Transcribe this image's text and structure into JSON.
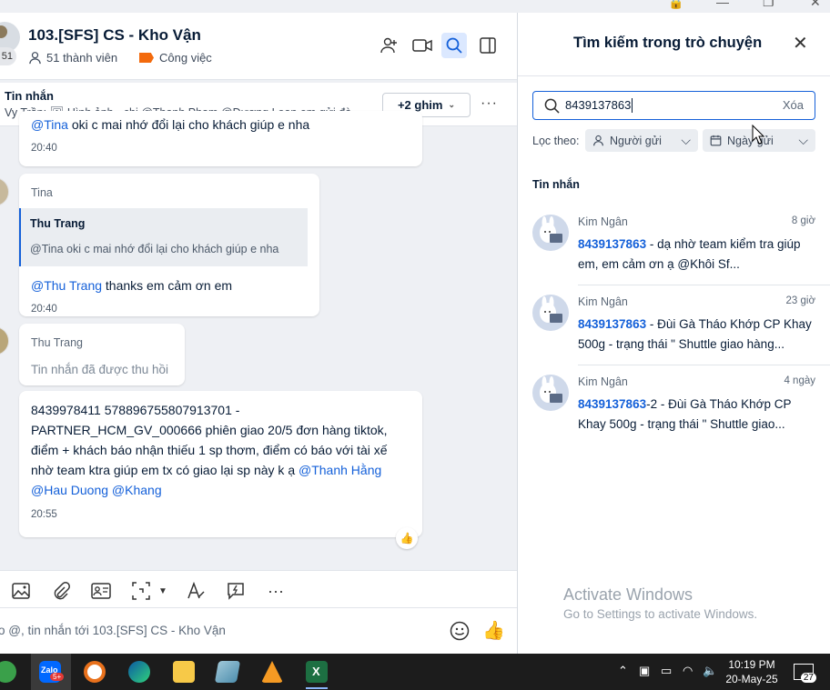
{
  "chat": {
    "title": "103.[SFS] CS - Kho Vận",
    "avatar_count": "51",
    "members": "51 thành viên",
    "tag": "Công việc",
    "tag_color": "#f36a0c"
  },
  "pinned": {
    "label": "Tin nhắn",
    "preview": "Vy Trần: 🖼 Hình ảnh · chị @Thanh Phạm @Dương Loan em gửi đà...",
    "more_button": "+2 ghim"
  },
  "messages": [
    {
      "mention": "@Tina",
      "text": " oki c mai nhớ đổi lại cho khách giúp e nha",
      "time": "20:40"
    },
    {
      "sender": "Tina",
      "quote_name": "Thu Trang",
      "quote_text": "@Tina oki c mai nhớ đổi lại cho khách giúp e nha",
      "mention": "@Thu Trang",
      "text": " thanks em cảm ơn em",
      "time": "20:40"
    },
    {
      "sender": "Thu Trang",
      "recalled": "Tin nhắn đã được thu hồi"
    },
    {
      "text": "8439978411 578896755807913701 - PARTNER_HCM_GV_000666 phiên giao 20/5 đơn hàng tiktok, điểm + khách báo nhận thiếu 1 sp thơm, điểm có báo với tài xế nhờ team ktra giúp em tx có giao lại sp này k ạ ",
      "mentions": "@Thanh Hằng @Hau Duong @Khang",
      "time": "20:55"
    }
  ],
  "composer": {
    "placeholder": "o @, tin nhắn tới 103.[SFS] CS - Kho Vận"
  },
  "search_panel": {
    "title": "Tìm kiếm trong trò chuyện",
    "query": "8439137863",
    "clear_label": "Xóa",
    "filter_label": "Lọc theo:",
    "filter_sender": "Người gửi",
    "filter_date": "Ngày gửi",
    "section_label": "Tin nhắn",
    "results": [
      {
        "name": "Kim Ngân",
        "time": "8 giờ",
        "hit": "8439137863",
        "text": " - dạ nhờ team kiểm tra giúp em, em cảm ơn ạ @Khôi Sf..."
      },
      {
        "name": "Kim Ngân",
        "time": "23 giờ",
        "hit": "8439137863",
        "text": " - Đùi Gà Tháo Khớp CP Khay 500g - trạng thái \" Shuttle giao hàng..."
      },
      {
        "name": "Kim Ngân",
        "time": "4 ngày",
        "hit": "8439137863",
        "text": "-2 - Đùi Gà Tháo Khớp CP Khay 500g - trạng thái \" Shuttle giao..."
      }
    ],
    "watermark_title": "Activate Windows",
    "watermark_sub": "Go to Settings to activate Windows."
  },
  "taskbar": {
    "time": "10:19 PM",
    "date": "20-May-25",
    "notif_count": "27",
    "badge": "5+"
  },
  "colors": {
    "accent": "#1460d9",
    "taskbar": "#1c1c1c"
  }
}
